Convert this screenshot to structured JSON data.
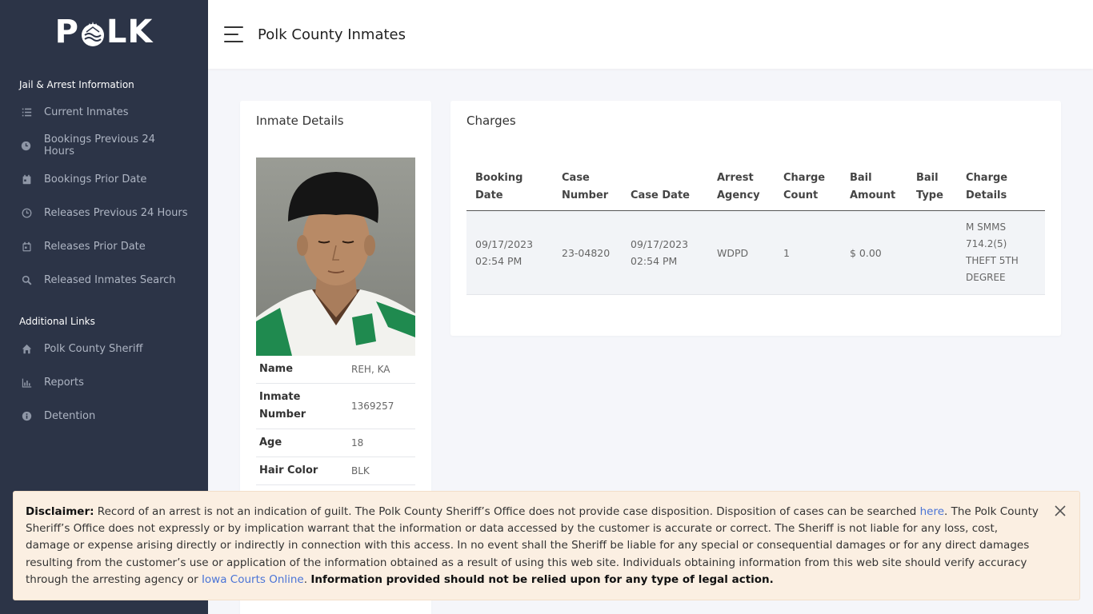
{
  "logo": {
    "text_left": "P",
    "text_right": "LK"
  },
  "sidebar": {
    "section1_title": "Jail & Arrest Information",
    "items1": [
      {
        "label": "Current Inmates",
        "icon": "list-icon"
      },
      {
        "label": "Bookings Previous 24 Hours",
        "icon": "clock-icon"
      },
      {
        "label": "Bookings Prior Date",
        "icon": "calendar-icon"
      },
      {
        "label": "Releases Previous 24 Hours",
        "icon": "clock-outline-icon"
      },
      {
        "label": "Releases Prior Date",
        "icon": "calendar-outline-icon"
      },
      {
        "label": "Released Inmates Search",
        "icon": "search-icon"
      }
    ],
    "section2_title": "Additional Links",
    "items2": [
      {
        "label": "Polk County Sheriff",
        "icon": "home-icon"
      },
      {
        "label": "Reports",
        "icon": "bar-chart-icon"
      },
      {
        "label": "Detention",
        "icon": "info-icon"
      }
    ]
  },
  "header": {
    "title": "Polk County Inmates"
  },
  "inmate": {
    "card_title": "Inmate Details",
    "details": [
      {
        "key": "Name",
        "value": "REH, KA"
      },
      {
        "key": "Inmate Number",
        "value": "1369257"
      },
      {
        "key": "Age",
        "value": "18"
      },
      {
        "key": "Hair Color",
        "value": "BLK"
      }
    ]
  },
  "charges": {
    "card_title": "Charges",
    "columns": [
      "Booking Date",
      "Case Number",
      "Case Date",
      "Arrest Agency",
      "Charge Count",
      "Bail Amount",
      "Bail Type",
      "Charge Details"
    ],
    "rows": [
      {
        "booking_date": "09/17/2023 02:54 PM",
        "case_number": "23-04820",
        "case_date": "09/17/2023 02:54 PM",
        "arrest_agency": "WDPD",
        "charge_count": "1",
        "bail_amount": "$ 0.00",
        "bail_type": "",
        "charge_details": "M SMMS 714.2(5) THEFT 5TH DEGREE"
      }
    ]
  },
  "disclaimer": {
    "label": "Disclaimer:",
    "text1": " Record of an arrest is not an indication of guilt. The Polk County Sheriff’s Office does not provide case disposition. Disposition of cases can be searched ",
    "link1": "here",
    "text2": ". The Polk County Sheriff’s Office does not expressly or by implication warrant that the information or data accessed by the customer is accurate or correct. The Sheriff is not liable for any loss, cost, damage or expense arising directly or indirectly in connection with this access. In no event shall the Sheriff be liable for any special or consequential damages or for any direct damages resulting from the customer’s use or application of the information obtained as a result of using this web site. Individuals obtaining information from this web site should verify accuracy through the arresting agency or ",
    "link2": "Iowa Courts Online",
    "text3": ". ",
    "bold_end": "Information provided should not be relied upon for any type of legal action."
  }
}
